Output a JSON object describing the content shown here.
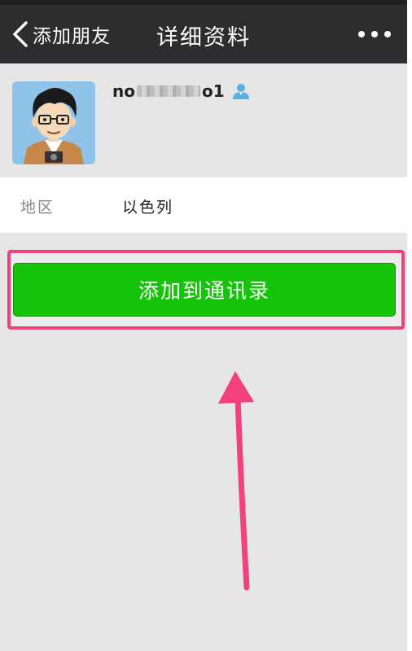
{
  "navbar": {
    "back_label": "添加朋友",
    "title": "详细资料",
    "more_icon": "more-dots-icon",
    "bg_color": "#2b2d2f"
  },
  "profile": {
    "nickname_prefix": "no",
    "nickname_suffix": "o1",
    "avatar_icon": "cartoon-avatar",
    "gender_icon": "male-icon",
    "gender_color": "#5ab0e0"
  },
  "details": {
    "region_label": "地区",
    "region_value": "以色列"
  },
  "actions": {
    "add_contact_label": "添加到通讯录",
    "button_color": "#17c20a",
    "highlight_color": "#f0427a"
  }
}
